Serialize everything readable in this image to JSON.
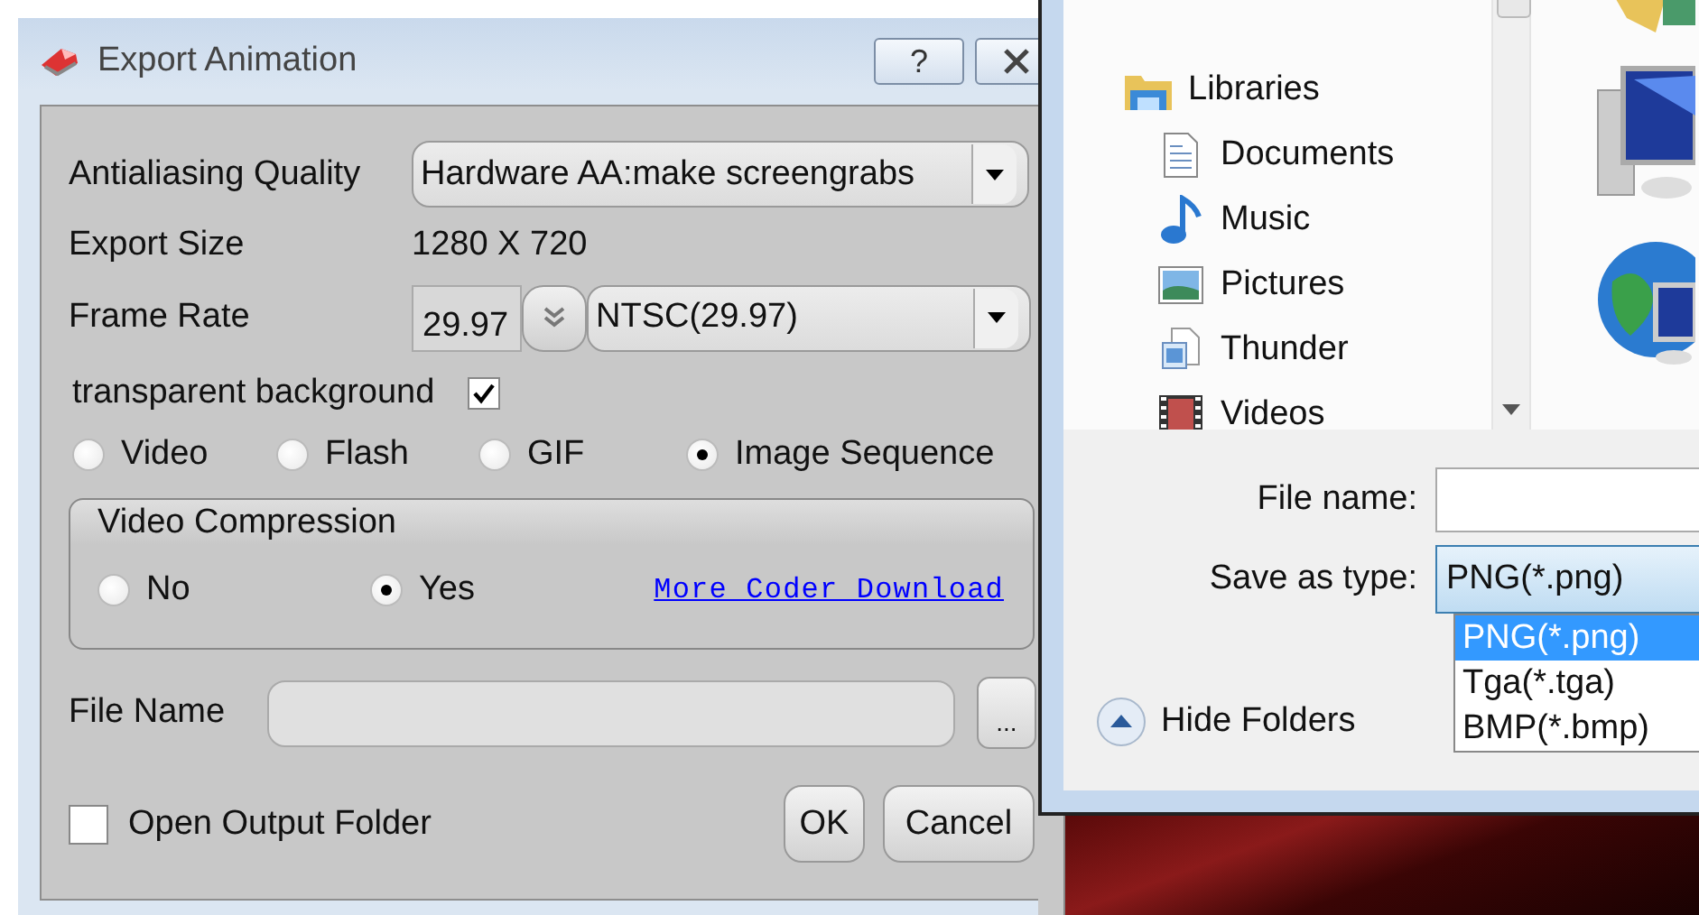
{
  "export_dialog": {
    "title": "Export Animation",
    "help_button": "?",
    "antialiasing": {
      "label": "Antialiasing Quality",
      "value": "Hardware AA:make screengrabs"
    },
    "export_size": {
      "label": "Export Size",
      "value": "1280 X 720"
    },
    "frame_rate": {
      "label": "Frame Rate",
      "value": "29.97",
      "preset": "NTSC(29.97)"
    },
    "transparent_background": {
      "label": "transparent background",
      "checked": true
    },
    "formats": [
      {
        "label": "Video",
        "selected": false
      },
      {
        "label": "Flash",
        "selected": false
      },
      {
        "label": "GIF",
        "selected": false
      },
      {
        "label": "Image Sequence",
        "selected": true
      }
    ],
    "video_compression": {
      "title": "Video Compression",
      "options": [
        {
          "label": "No",
          "selected": false
        },
        {
          "label": "Yes",
          "selected": true
        }
      ],
      "link": "More Coder Download"
    },
    "file_name": {
      "label": "File Name",
      "browse_button": "..."
    },
    "open_output_folder": {
      "label": "Open Output Folder",
      "checked": false
    },
    "buttons": [
      "OK",
      "Cancel"
    ]
  },
  "save_dialog": {
    "navigation": [
      {
        "label": "Libraries",
        "children": [
          {
            "label": "Documents"
          },
          {
            "label": "Music"
          },
          {
            "label": "Pictures"
          },
          {
            "label": "Thunder"
          },
          {
            "label": "Videos"
          }
        ]
      }
    ],
    "file_name_label": "File name:",
    "save_as_type_label": "Save as type:",
    "save_as_type_value": "PNG(*.png)",
    "type_options": [
      {
        "label": "PNG(*.png)",
        "selected": true
      },
      {
        "label": "Tga(*.tga)",
        "selected": false
      },
      {
        "label": "BMP(*.bmp)",
        "selected": false
      }
    ],
    "hide_folders": "Hide Folders"
  }
}
